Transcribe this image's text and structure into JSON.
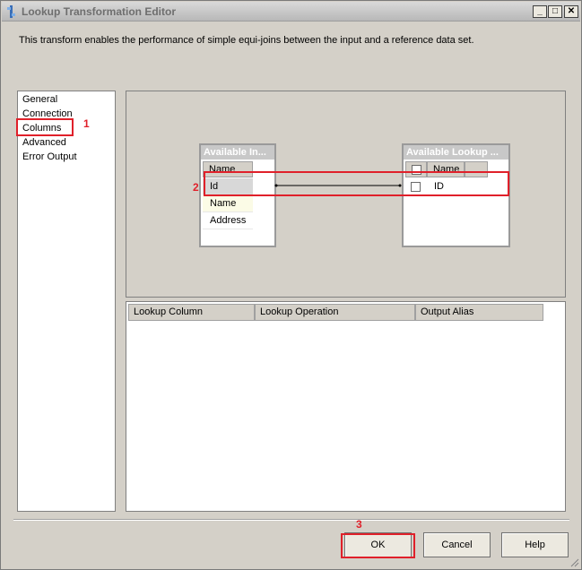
{
  "window": {
    "title": "Lookup Transformation Editor",
    "minimize_label": "_",
    "maximize_label": "□",
    "close_label": "✕"
  },
  "description": "This transform enables the performance of simple equi-joins between the input and a reference data set.",
  "nav": {
    "items": [
      {
        "label": "General"
      },
      {
        "label": "Connection"
      },
      {
        "label": "Columns",
        "selected": true
      },
      {
        "label": "Advanced"
      },
      {
        "label": "Error Output"
      }
    ]
  },
  "input_table": {
    "title": "Available In...",
    "header": "Name",
    "rows": [
      "Id",
      "Name",
      "Address"
    ]
  },
  "lookup_table": {
    "title": "Available Lookup ...",
    "header": "Name",
    "rows": [
      "ID"
    ]
  },
  "grid": {
    "columns": [
      "Lookup Column",
      "Lookup Operation",
      "Output Alias"
    ]
  },
  "buttons": {
    "ok": "OK",
    "cancel": "Cancel",
    "help": "Help"
  },
  "annotations": {
    "one": "1",
    "two": "2",
    "three": "3",
    "color": "#e0202a"
  },
  "icons": {
    "title": "lookup-transform-icon",
    "minimize": "minimize-icon",
    "maximize": "maximize-icon",
    "close": "close-icon",
    "checkbox": "checkbox-icon",
    "grip": "resize-grip-icon"
  }
}
